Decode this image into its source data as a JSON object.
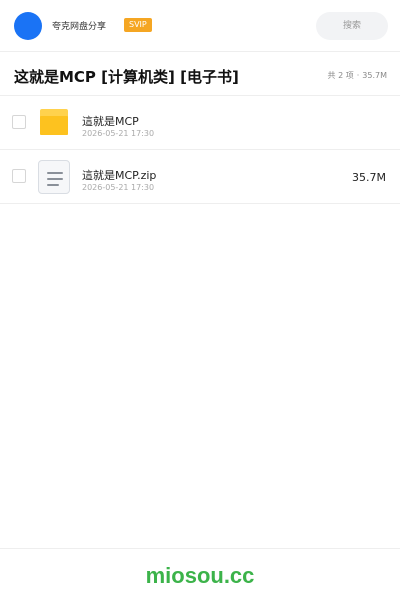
{
  "header": {
    "app_name": "夸克网盘分享",
    "badge": "SVIP",
    "search_placeholder": "搜索",
    "accent_color": "#1a73f5",
    "badge_color": "#f5a623"
  },
  "share": {
    "title": "这就是MCP [计算机类] [电子书]",
    "count_text": "共 2 项",
    "separator": "·",
    "total_size": "35.7M"
  },
  "files": [
    {
      "name": "這就是MCP",
      "date": "2026-05-21 17:30",
      "size": "",
      "icon": "folder-icon"
    },
    {
      "name": "這就是MCP.zip",
      "date": "2026-05-21 17:30",
      "size": "35.7M",
      "icon": "zip-file-icon"
    }
  ],
  "footer": {
    "brand": "miosou.cc",
    "brand_color": "#3cb34a"
  }
}
